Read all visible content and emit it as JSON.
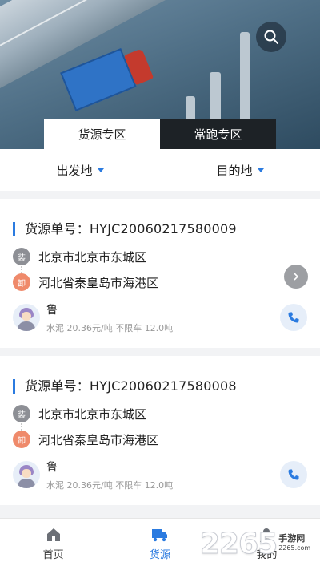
{
  "tabs": [
    {
      "label": "货源专区",
      "active": true
    },
    {
      "label": "常跑专区",
      "active": false
    }
  ],
  "filters": [
    {
      "label": "出发地"
    },
    {
      "label": "目的地"
    }
  ],
  "cards": [
    {
      "order_label": "货源单号：HYJC20060217580009",
      "load_badge": "装",
      "load_address": "北京市北京市东城区",
      "unload_badge": "卸",
      "unload_address": "河北省秦皇岛市海港区",
      "driver": "鲁",
      "cargo": "水泥 20.36元/吨 不限车 12.0吨"
    },
    {
      "order_label": "货源单号：HYJC20060217580008",
      "load_badge": "装",
      "load_address": "北京市北京市东城区",
      "unload_badge": "卸",
      "unload_address": "河北省秦皇岛市海港区",
      "driver": "鲁",
      "cargo": "水泥 20.36元/吨 不限车 12.0吨"
    }
  ],
  "nav": [
    {
      "label": "首页",
      "icon": "home-icon",
      "active": false
    },
    {
      "label": "货源",
      "icon": "truck-icon",
      "active": true
    },
    {
      "label": "我的",
      "icon": "user-icon",
      "active": false
    }
  ],
  "watermark": {
    "number": "2265",
    "cn": "手游网",
    "en": "2265.com"
  },
  "colors": {
    "accent": "#2b7be0",
    "load_badge": "#8d8f95",
    "unload_badge": "#ef8a6b",
    "tab_dark": "#1d2226"
  },
  "icons": {
    "search": "search-icon",
    "phone": "phone-icon",
    "arrow": "chevron-right-icon"
  }
}
